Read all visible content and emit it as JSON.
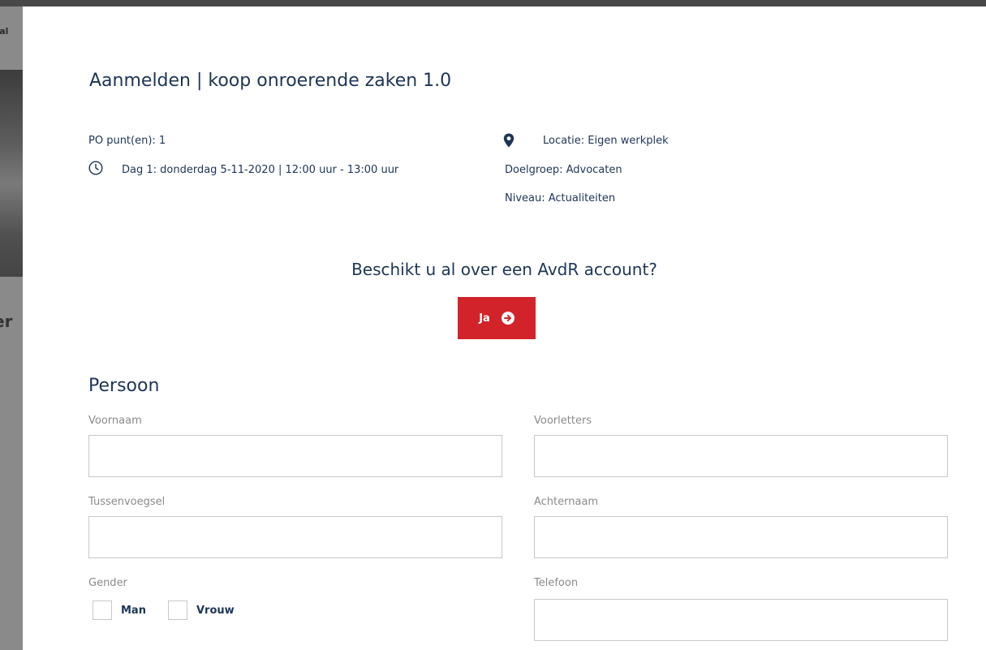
{
  "background": {
    "top_text_fragment": "tal",
    "mid_text_fragment": "er"
  },
  "modal": {
    "title": "Aanmelden | koop onroerende zaken 1.0",
    "info_left": {
      "po_points": "PO punt(en): 1",
      "day": "Dag 1: donderdag 5-11-2020 | 12:00 uur - 13:00 uur"
    },
    "info_right": {
      "location": "Locatie: Eigen werkplek",
      "audience": "Doelgroep: Advocaten",
      "level": "Niveau: Actualiteiten"
    },
    "account_question": "Beschikt u al over een AvdR account?",
    "yes_button": "Ja",
    "section_person": "Persoon",
    "fields": {
      "voornaam": {
        "label": "Voornaam",
        "value": ""
      },
      "voorletters": {
        "label": "Voorletters",
        "value": ""
      },
      "tussenvoegsel": {
        "label": "Tussenvoegsel",
        "value": ""
      },
      "achternaam": {
        "label": "Achternaam",
        "value": ""
      },
      "telefoon": {
        "label": "Telefoon",
        "value": ""
      }
    },
    "gender": {
      "label": "Gender",
      "options": [
        "Man",
        "Vrouw"
      ]
    }
  },
  "colors": {
    "primary_text": "#1d3557",
    "accent_red": "#d2232a",
    "label_gray": "#8a8a8a",
    "input_border": "#c8c8c8"
  },
  "icons": {
    "location": "map-pin-icon",
    "time": "clock-icon",
    "button": "arrow-right-circle-icon"
  }
}
